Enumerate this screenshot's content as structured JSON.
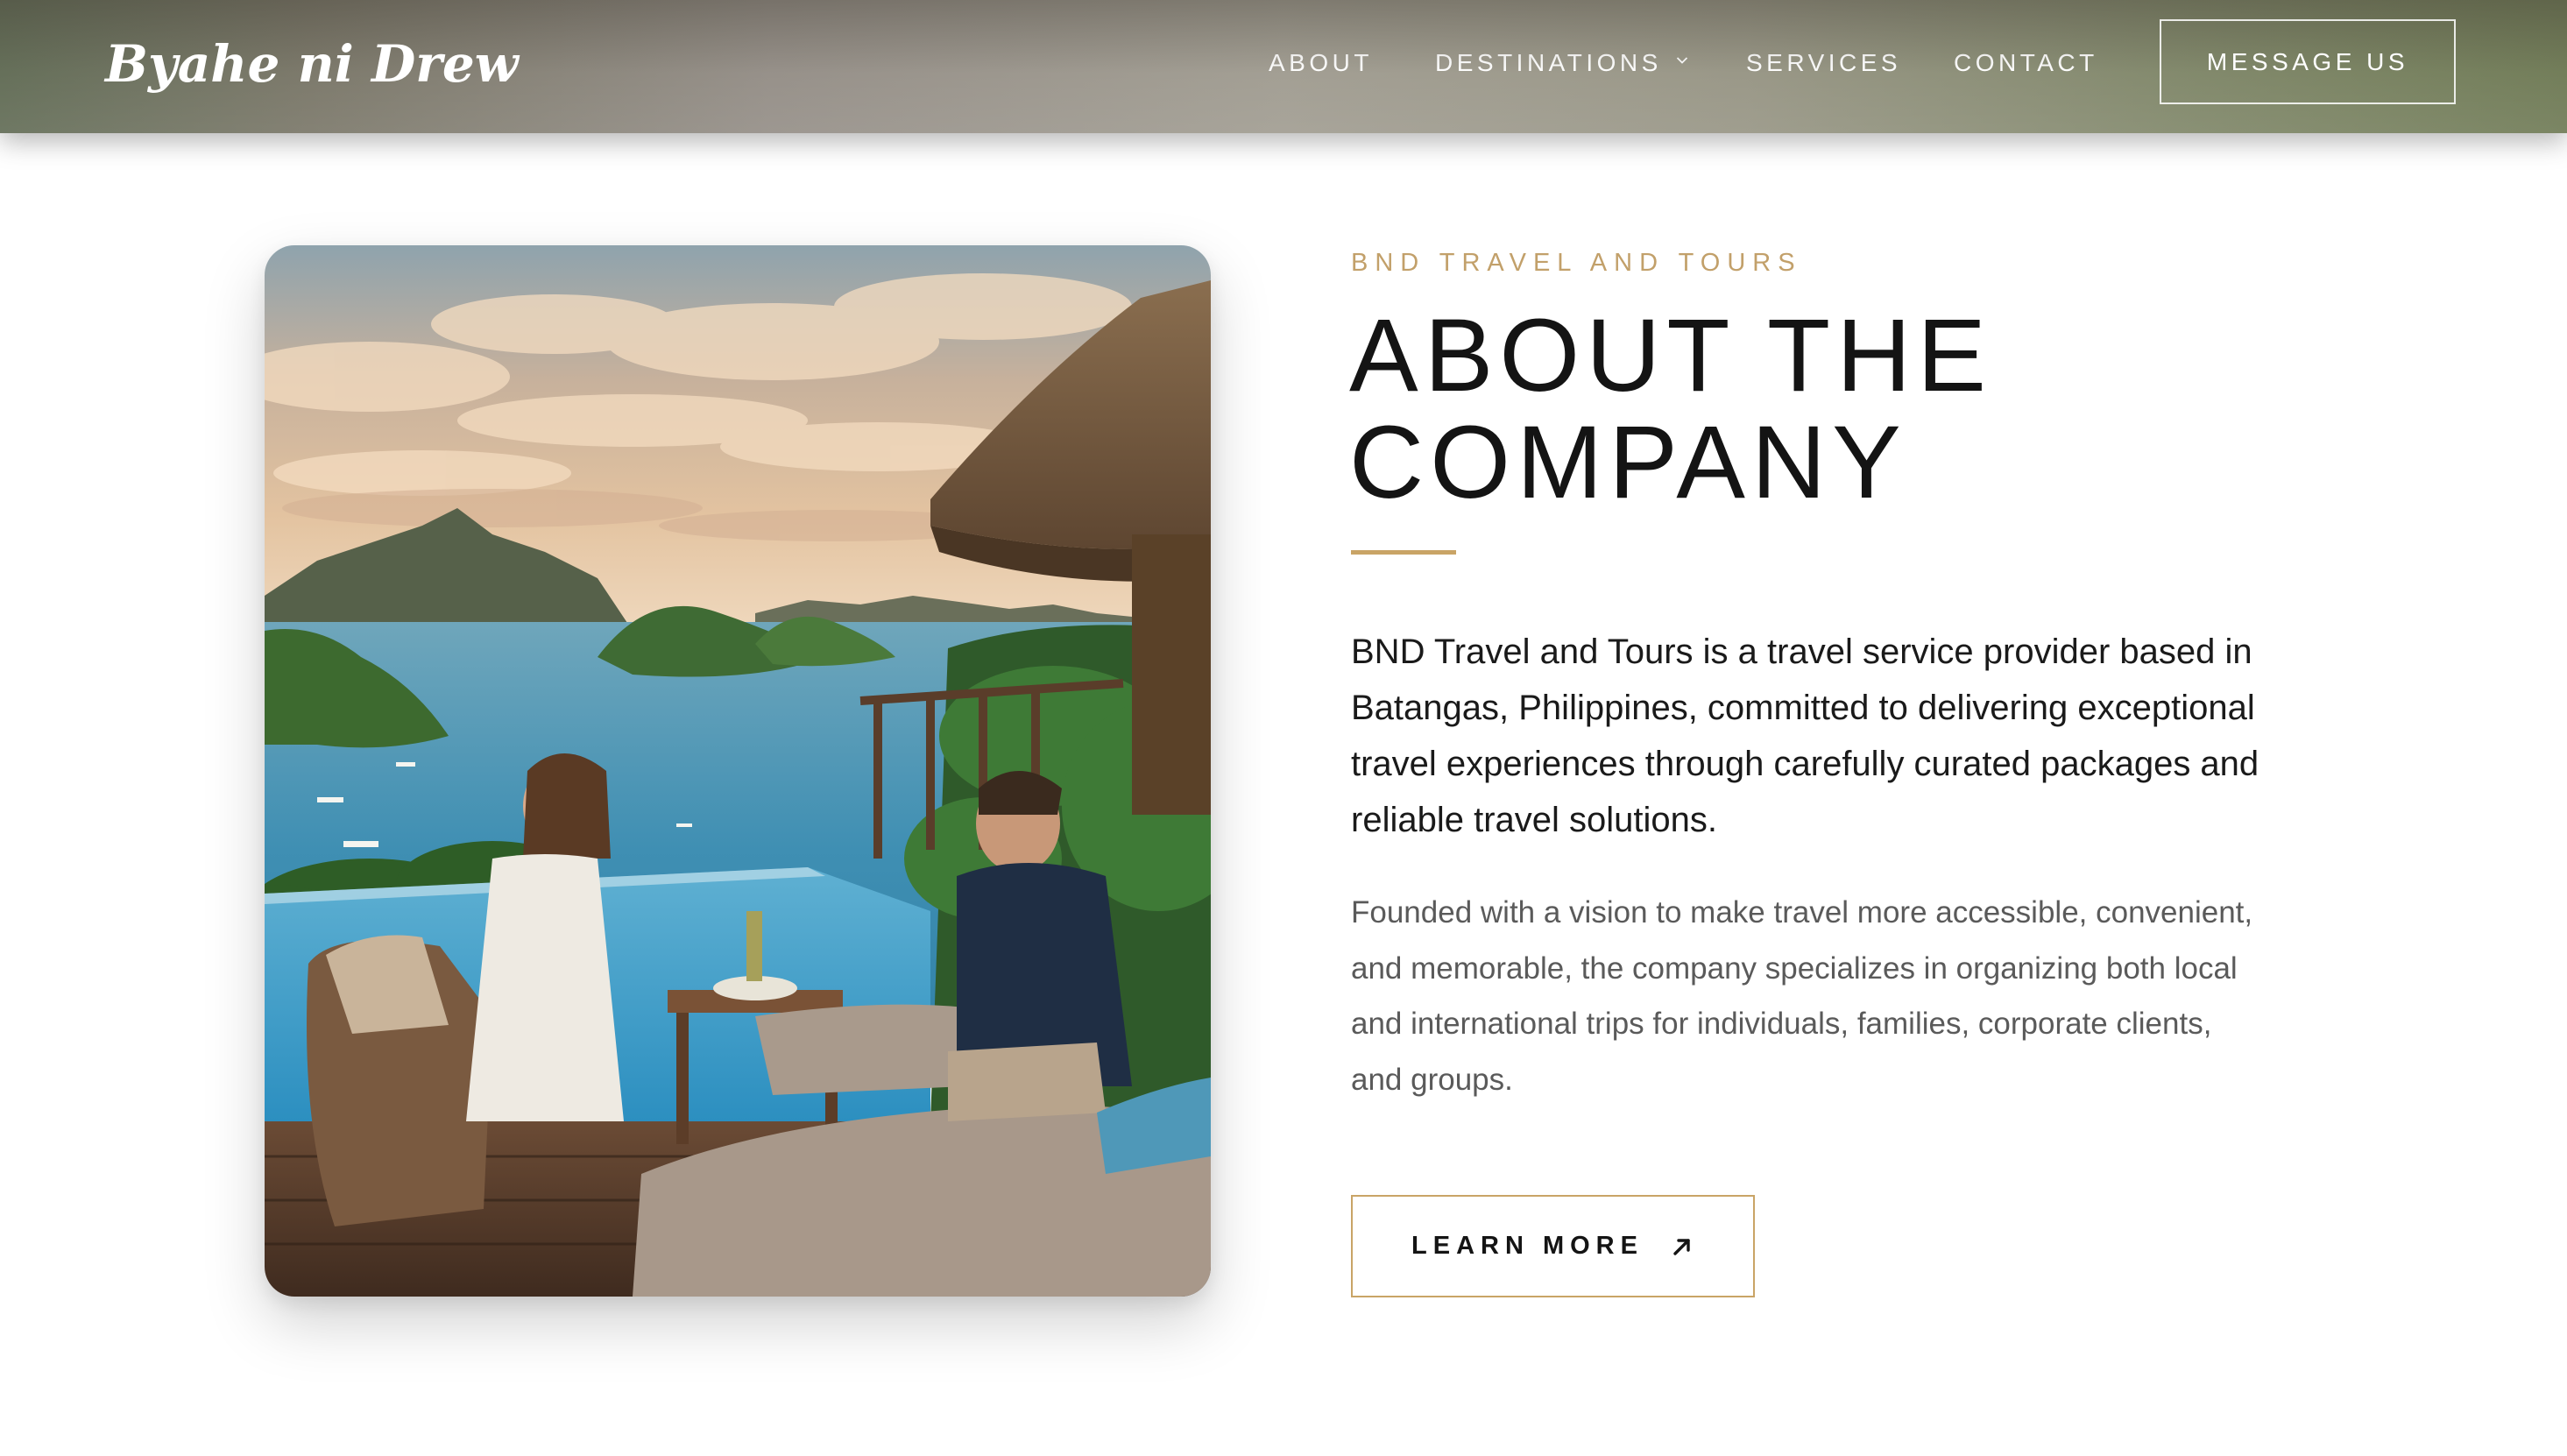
{
  "header": {
    "logo": "Byahe ni Drew",
    "nav": [
      {
        "label": "ABOUT"
      },
      {
        "label": "DESTINATIONS",
        "icon": "chevron-down-icon"
      },
      {
        "label": "SERVICES"
      },
      {
        "label": "CONTACT"
      }
    ],
    "cta_label": "MESSAGE US"
  },
  "about": {
    "eyebrow": "BND TRAVEL AND TOURS",
    "title_line1": "ABOUT THE",
    "title_line2": "COMPANY",
    "lead": "BND Travel and Tours is a travel service provider based in Batangas, Philippines, committed to delivering exceptional travel experiences through carefully curated packages and reliable travel solutions.",
    "body": "Founded with a vision to make travel more accessible, convenient, and memorable, the company specializes in organizing both local and international trips for individuals, families, corporate clients, and groups.",
    "button_label": "LEARN MORE",
    "button_icon": "arrow-up-right-icon"
  },
  "colors": {
    "accent": "#c9a466",
    "eyebrow": "#c2a06a",
    "heading": "#141414",
    "body": "#5a5a5a"
  }
}
